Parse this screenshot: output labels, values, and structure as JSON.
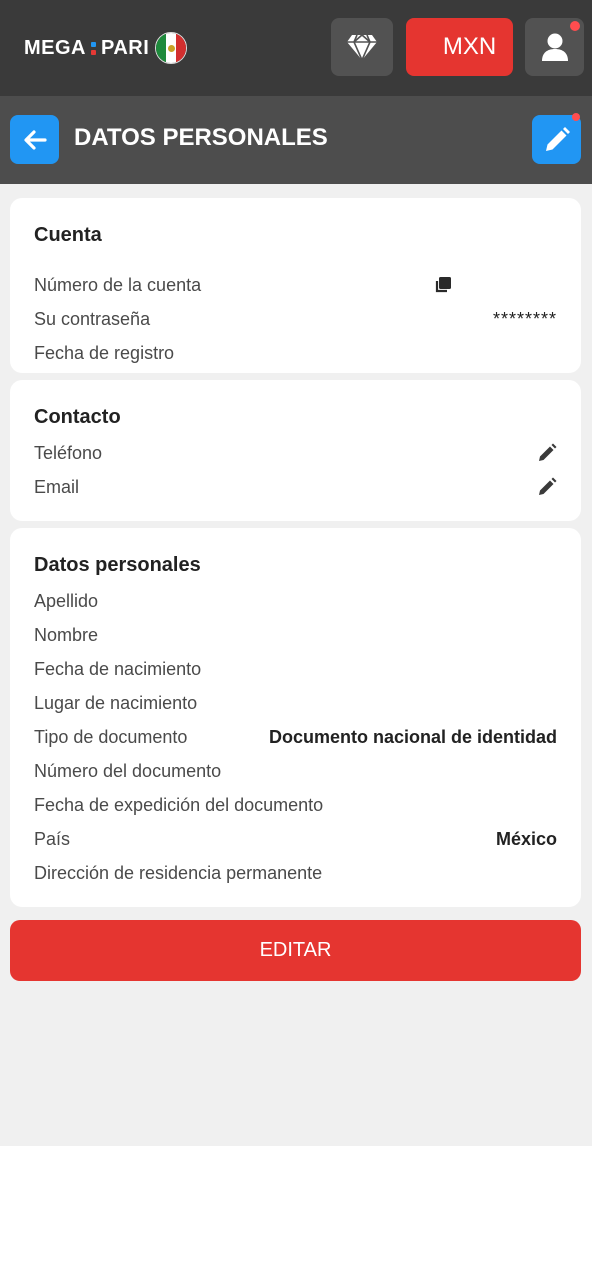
{
  "header": {
    "logo_left": "MEGA",
    "logo_right": "PARI",
    "currency": "MXN",
    "accent": "#e53530"
  },
  "subheader": {
    "title": "DATOS PERSONALES"
  },
  "cards": {
    "cuenta": {
      "title": "Cuenta",
      "rows": [
        {
          "label": "Número de la cuenta",
          "value": ""
        },
        {
          "label": "Su contraseña",
          "value": "********"
        },
        {
          "label": "Fecha de registro",
          "value": ""
        }
      ]
    },
    "contacto": {
      "title": "Contacto",
      "rows": [
        {
          "label": "Teléfono",
          "value": ""
        },
        {
          "label": "Email",
          "value": ""
        }
      ]
    },
    "personales": {
      "title": "Datos personales",
      "rows": [
        {
          "label": "Apellido",
          "value": ""
        },
        {
          "label": "Nombre",
          "value": ""
        },
        {
          "label": "Fecha de nacimiento",
          "value": ""
        },
        {
          "label": "Lugar de nacimiento",
          "value": ""
        },
        {
          "label": "Tipo de documento",
          "value": "Documento nacional de identidad"
        },
        {
          "label": "Número del documento",
          "value": ""
        },
        {
          "label": "Fecha de expedición del documento",
          "value": ""
        },
        {
          "label": "País",
          "value": "México"
        },
        {
          "label": "Dirección de residencia permanente",
          "value": ""
        }
      ]
    }
  },
  "actions": {
    "edit_label": "EDITAR"
  },
  "icons": {
    "diamond": "diamond-icon",
    "user": "user-icon",
    "back": "arrow-left-icon",
    "edit": "pencil-icon",
    "copy": "copy-icon"
  }
}
